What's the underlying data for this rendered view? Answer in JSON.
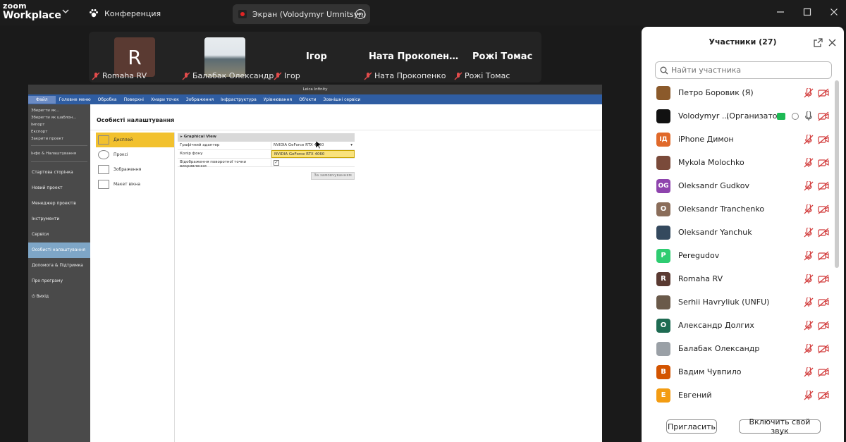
{
  "app": {
    "logo_line1": "zoom",
    "logo_line2": "Workplace",
    "tab_conference": "Конференция",
    "tab_screen": "Экран (Volodymyr Umnitsyn)"
  },
  "video_strip": {
    "tiles": [
      {
        "name": "Romaha RV",
        "avatar_letter": "R",
        "avatar_color": "#5a3a32"
      },
      {
        "name": "Балабак Олександр"
      },
      {
        "name": "Ігор",
        "display": "Ігор"
      },
      {
        "name": "Ната Прокопенко",
        "display": "Ната  Прокопен…"
      },
      {
        "name": "Рожі Томас",
        "display": "Рожі Томас"
      }
    ]
  },
  "shared_screen": {
    "window_title": "Leica Infinity",
    "menu": [
      "Файл",
      "Головне меню",
      "Обробка",
      "Поверхні",
      "Хмари точок",
      "Зображення",
      "Інфраструктура",
      "Урівнювання",
      "Об'єкти",
      "Зовнішні сервіси"
    ],
    "sidebar_small": [
      "Зберегти як...",
      "Зберегти як шаблон...",
      "Імпорт",
      "Експорт",
      "Закрити проект"
    ],
    "sidebar_info": "Інфо & Налаштування",
    "sidebar_items": [
      "Стартова сторінка",
      "Новий проект",
      "Менеджер проектів",
      "Інструменти",
      "Сервіси",
      "Особисті налаштування",
      "Допомога & Підтримка",
      "Про програму"
    ],
    "sidebar_exit": "Вихід",
    "heading": "Особисті налаштування",
    "categories": [
      "Дисплей",
      "Проксі",
      "Зображення",
      "Макет вікна"
    ],
    "group_title": "Graphical View",
    "rows": [
      {
        "key": "Графічний адаптер",
        "value": "NVIDIA GeForce RTX 4060"
      },
      {
        "key": "Колір фону",
        "value": "NVIDIA GeForce RTX 4060"
      },
      {
        "key": "Відображення поворотної точки викривлення",
        "value": "✓"
      }
    ],
    "defaults_button": "За замовчуванням"
  },
  "participants": {
    "title": "Участники (27)",
    "search_placeholder": "Найти участника",
    "list": [
      {
        "name": "Петро Боровик (Я)",
        "avatar_letter": "",
        "avatar_color": "#8b5a2b"
      },
      {
        "name": "Volodymyr ...",
        "role": "(Организатор)",
        "avatar_letter": "",
        "avatar_color": "#111111"
      },
      {
        "name": "iPhone Димон",
        "avatar_letter": "ІД",
        "avatar_color": "#e0692a"
      },
      {
        "name": "Mykola Molochko",
        "avatar_letter": "",
        "avatar_color": "#7a4a3a"
      },
      {
        "name": "Oleksandr Gudkov",
        "avatar_letter": "OG",
        "avatar_color": "#8e44ad"
      },
      {
        "name": "Oleksandr Tranchenko",
        "avatar_letter": "O",
        "avatar_color": "#8a6d5a"
      },
      {
        "name": "Oleksandr Yanchuk",
        "avatar_letter": "",
        "avatar_color": "#34495e"
      },
      {
        "name": "Peregudov",
        "avatar_letter": "P",
        "avatar_color": "#2ecc71"
      },
      {
        "name": "Romaha RV",
        "avatar_letter": "R",
        "avatar_color": "#5a3a32"
      },
      {
        "name": "Serhii Havryliuk (UNFU)",
        "avatar_letter": "",
        "avatar_color": "#6a5a4a"
      },
      {
        "name": "Александр Долгих",
        "avatar_letter": "O",
        "avatar_color": "#1e6b52"
      },
      {
        "name": "Балабак Олександр",
        "avatar_letter": "",
        "avatar_color": "#9aa0a6"
      },
      {
        "name": "Вадим Чувпило",
        "avatar_letter": "B",
        "avatar_color": "#d35400"
      },
      {
        "name": "Евгений",
        "avatar_letter": "E",
        "avatar_color": "#f39c12"
      }
    ],
    "invite_button": "Пригласить",
    "unmute_button": "Включить свой звук"
  }
}
